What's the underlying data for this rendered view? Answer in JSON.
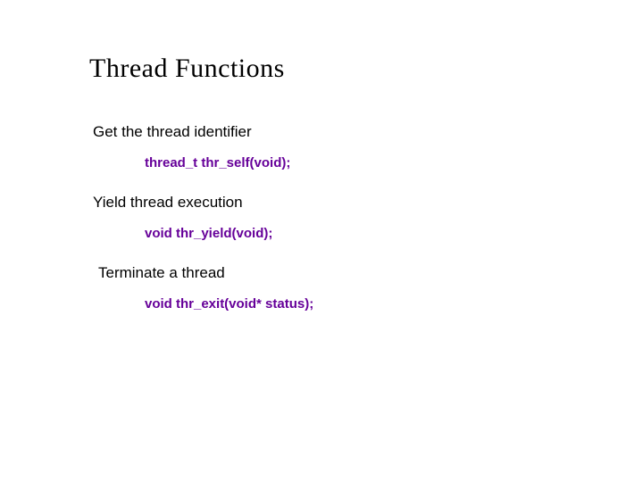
{
  "title": "Thread Functions",
  "sections": [
    {
      "desc": "Get the thread identifier",
      "code": "thread_t thr_self(void);"
    },
    {
      "desc": "Yield thread execution",
      "code": "void thr_yield(void);"
    },
    {
      "desc": "Terminate a thread",
      "code": "void thr_exit(void* status);"
    }
  ]
}
